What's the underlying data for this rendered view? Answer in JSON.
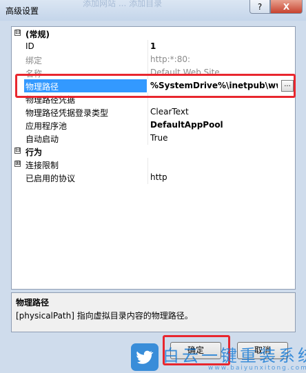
{
  "window": {
    "title": "高级设置",
    "ghost_title": "添加网站 ... 添加目录",
    "help_label": "?",
    "close_label": "X"
  },
  "properties": [
    {
      "type": "category",
      "toggle": "⊟",
      "label": "(常规)"
    },
    {
      "type": "prop",
      "label": "ID",
      "value": "1",
      "bold": true
    },
    {
      "type": "prop",
      "label": "绑定",
      "value": "http:*:80:",
      "gray": true
    },
    {
      "type": "prop",
      "label": "名称",
      "value": "Default Web Site",
      "gray": true
    },
    {
      "type": "prop",
      "label": "物理路径",
      "value": "%SystemDrive%\\inetpub\\wwwroot",
      "selected": true,
      "ellipsis": "..."
    },
    {
      "type": "prop",
      "label": "物理路径凭据",
      "value": ""
    },
    {
      "type": "prop",
      "label": "物理路径凭据登录类型",
      "value": "ClearText"
    },
    {
      "type": "prop",
      "label": "应用程序池",
      "value": "DefaultAppPool",
      "bold": true
    },
    {
      "type": "prop",
      "label": "自动启动",
      "value": "True"
    },
    {
      "type": "category",
      "toggle": "⊟",
      "label": "行为"
    },
    {
      "type": "prop",
      "label": "连接限制",
      "value": "",
      "expandable": true,
      "toggle": "⊞"
    },
    {
      "type": "prop",
      "label": "已启用的协议",
      "value": "http"
    }
  ],
  "description": {
    "title": "物理路径",
    "text": "[physicalPath] 指向虚拟目录内容的物理路径。"
  },
  "buttons": {
    "ok": "确定",
    "cancel": "取消"
  },
  "watermark": {
    "text": "白云一键重装系统",
    "url": "www.baiyunxitong.com"
  },
  "colors": {
    "selection": "#3399ff",
    "highlight_box": "#e8262e",
    "watermark": "#1f7fd6"
  }
}
